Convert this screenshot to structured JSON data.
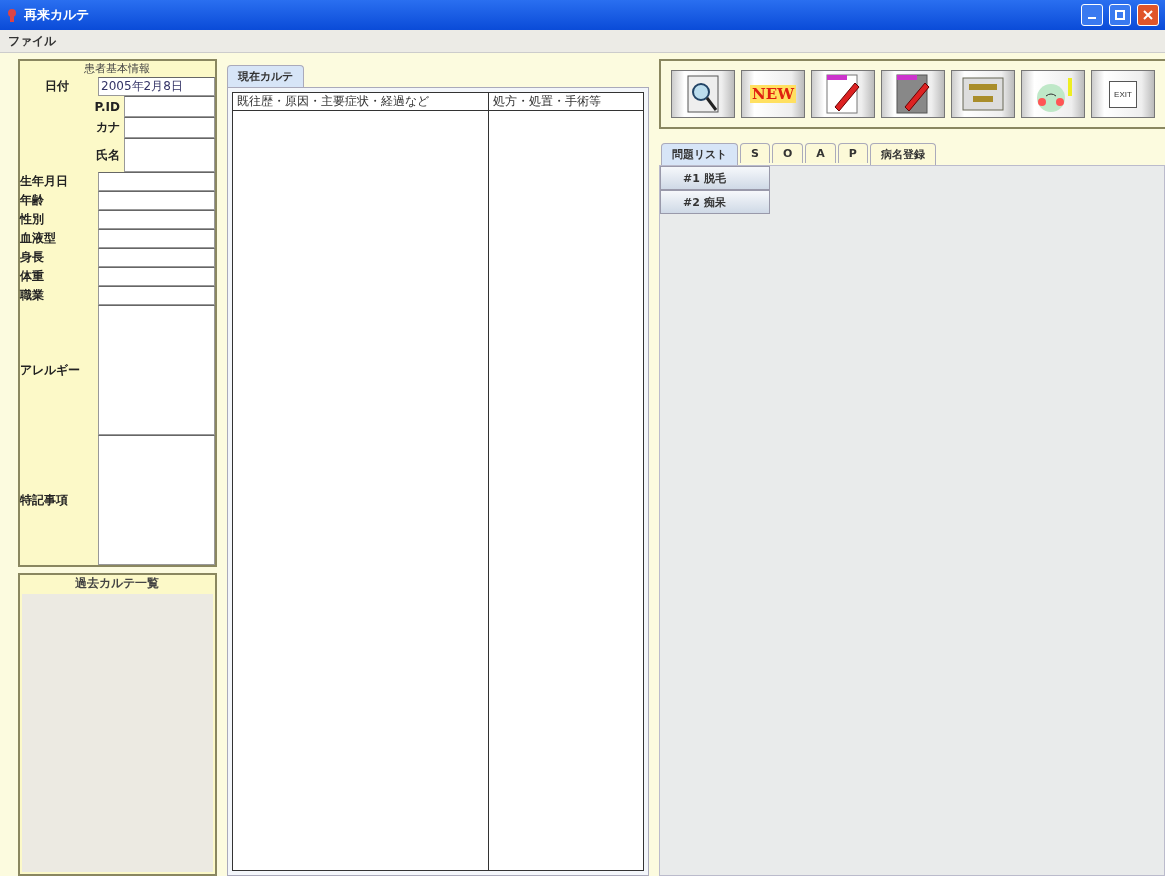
{
  "window": {
    "title": "再来カルテ"
  },
  "menu": [
    "ファイル"
  ],
  "patient": {
    "title": "患者基本情報",
    "date_label": "日付",
    "date_value": "2005年2月8日",
    "id_fields": [
      {
        "label": "P.ID"
      },
      {
        "label": "カナ"
      },
      {
        "label": "氏名"
      }
    ],
    "fields": [
      {
        "label": "生年月日",
        "kind": "line"
      },
      {
        "label": "年齢",
        "kind": "line"
      },
      {
        "label": "性別",
        "kind": "line"
      },
      {
        "label": "血液型",
        "kind": "line"
      },
      {
        "label": "身長",
        "kind": "line"
      },
      {
        "label": "体重",
        "kind": "line"
      },
      {
        "label": "職業",
        "kind": "line"
      },
      {
        "label": "アレルギー",
        "kind": "area"
      },
      {
        "label": "特記事項",
        "kind": "area"
      }
    ]
  },
  "past": {
    "title": "過去カルテ一覧"
  },
  "chart": {
    "tab": "現在カルテ",
    "columns": [
      "既往歴・原因・主要症状・経過など",
      "処方・処置・手術等"
    ]
  },
  "toolbar": [
    {
      "kind": "search"
    },
    {
      "kind": "new",
      "label": "NEW"
    },
    {
      "kind": "pencil"
    },
    {
      "kind": "pencil-dark"
    },
    {
      "kind": "board"
    },
    {
      "kind": "face"
    },
    {
      "kind": "exit",
      "label": "EXIT"
    }
  ],
  "tabs": [
    {
      "label": "問題リスト",
      "selected": true
    },
    {
      "label": "S",
      "selected": false
    },
    {
      "label": "O",
      "selected": false
    },
    {
      "label": "A",
      "selected": false
    },
    {
      "label": "P",
      "selected": false
    },
    {
      "label": "病名登録",
      "selected": false
    }
  ],
  "problems": [
    "#1 脱毛",
    "#2 痴呆"
  ]
}
